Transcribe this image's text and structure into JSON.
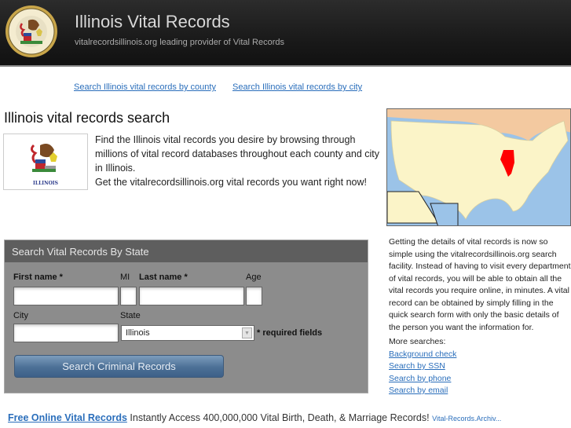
{
  "header": {
    "title": "Illinois Vital Records",
    "subtitle": "vitalrecordsillinois.org leading provider of Vital Records",
    "logo": "illinois-state-seal"
  },
  "toplinks": [
    {
      "label": "Search Illinois vital records by county"
    },
    {
      "label": "Search Illinois vital records by city"
    }
  ],
  "main": {
    "heading": "Illinois vital records search",
    "flag_caption": "ILLINOIS",
    "intro_1": "Find the Illinois vital records you desire by browsing through millions of vital record databases throughout each county and city in Illinois.",
    "intro_2": "Get the vitalrecordsillinois.org vital records you want right now!"
  },
  "form": {
    "title": "Search Vital Records By State",
    "first_name_label": "First name *",
    "mi_label": "MI",
    "last_name_label": "Last name *",
    "age_label": "Age",
    "city_label": "City",
    "state_label": "State",
    "state_value": "Illinois",
    "required_note": "* required fields",
    "submit_label": "Search Criminal Records",
    "first_name_value": "",
    "mi_value": "",
    "last_name_value": "",
    "age_value": "",
    "city_value": ""
  },
  "sidebar": {
    "map_highlight_color": "#ff0000",
    "description": "Getting the details of vital records is now so simple using the vitalrecordsillinois.org search facility. Instead of having to visit every department of vital records, you will be able to obtain all the vital records you require online, in minutes. A vital record can be obtained by simply filling in the quick search form with only the basic details of the person you want the information for.",
    "more_label": "More searches:",
    "links": [
      {
        "label": "Background check"
      },
      {
        "label": "Search by SSN"
      },
      {
        "label": "Search by phone"
      },
      {
        "label": "Search by email"
      }
    ]
  },
  "ad": {
    "link": "Free Online Vital Records",
    "text": "Instantly Access 400,000,000 Vital Birth, Death, & Marriage Records!",
    "source": "Vital-Records.Archiv..."
  }
}
